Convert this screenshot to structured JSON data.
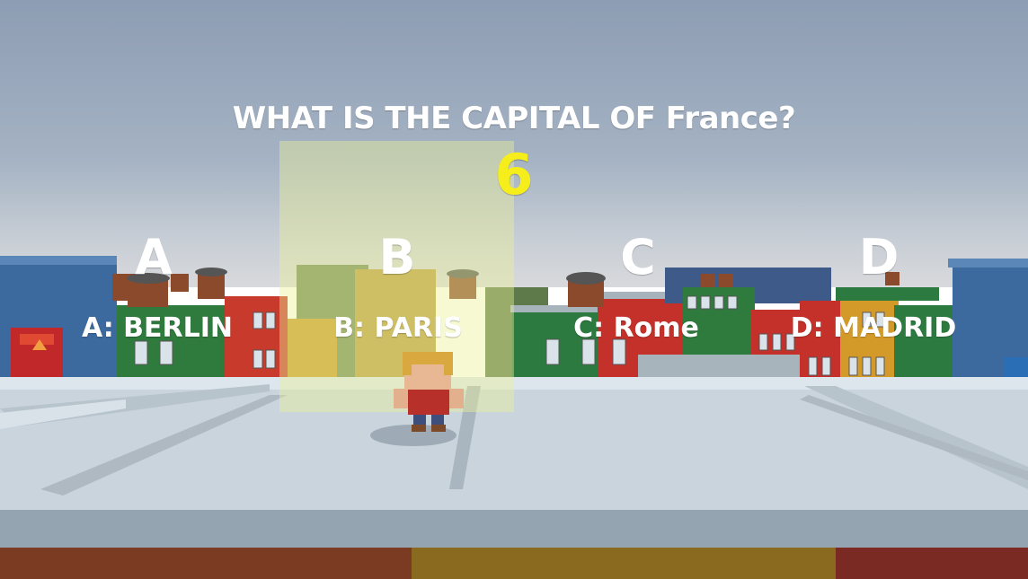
{
  "question": "WHAT IS THE CAPITAL OF France?",
  "timer": "6",
  "zones": [
    {
      "letter": "A",
      "answer": "A: BERLIN"
    },
    {
      "letter": "B",
      "answer": "B: PARIS"
    },
    {
      "letter": "C",
      "answer": "C: Rome"
    },
    {
      "letter": "D",
      "answer": "D: MADRID"
    }
  ],
  "selected_zone": "B",
  "colors": {
    "timer": "#f6ee1a",
    "highlight": "#ebf096",
    "text": "#ffffff"
  }
}
